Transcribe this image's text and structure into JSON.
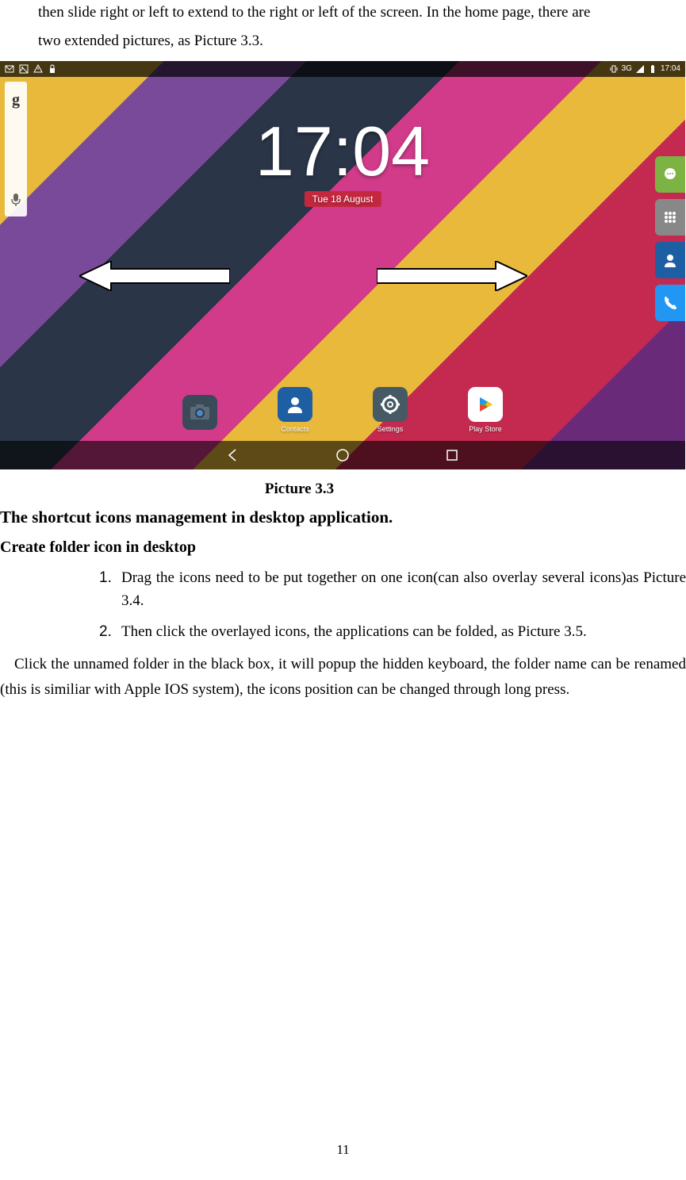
{
  "intro": {
    "line1": "then slide right or left to extend to the right or left of the screen. In the home page, there are",
    "line2": "two extended pictures, as Picture 3.3."
  },
  "screenshot": {
    "status": {
      "network": "3G",
      "time": "17:04"
    },
    "clock": {
      "time": "17:04",
      "date": "Tue 18 August"
    },
    "dock": [
      {
        "label": ""
      },
      {
        "label": "Contacts"
      },
      {
        "label": "Settings"
      },
      {
        "label": "Play Store"
      }
    ]
  },
  "pictureLabel": "Picture 3.3",
  "heading1": "The shortcut icons management in desktop application.",
  "heading2": "Create folder icon in desktop",
  "list": [
    {
      "num": "1.",
      "text": "Drag the icons need to be put together on one icon(can also overlay several icons)as Picture 3.4."
    },
    {
      "num": "2.",
      "text": "Then click the overlayed icons, the applications can be folded, as Picture 3.5."
    }
  ],
  "para": "Click the unnamed folder in the black box, it will popup the hidden keyboard, the folder name can be renamed (this is similiar with Apple IOS system), the icons position can be changed through long press.",
  "pageNum": "11"
}
